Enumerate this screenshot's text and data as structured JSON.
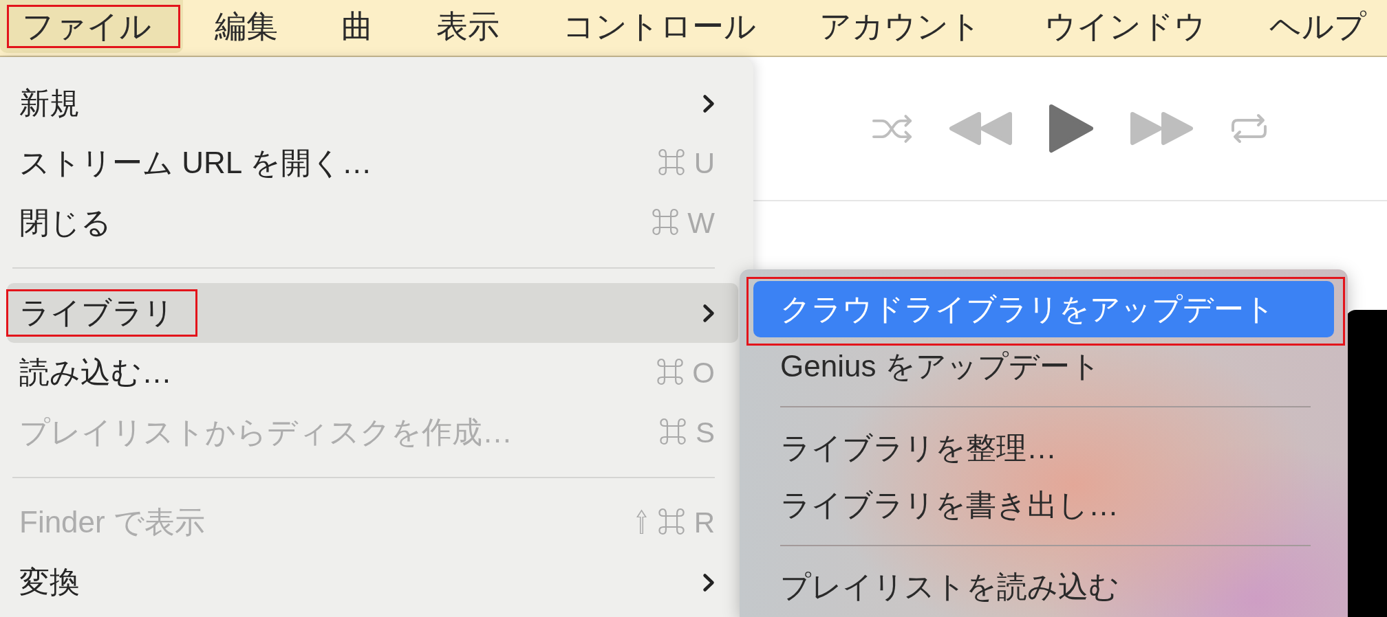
{
  "menu_bar": {
    "items": [
      {
        "label": "ファイル",
        "selected": true,
        "annotated": true
      },
      {
        "label": "編集",
        "selected": false,
        "annotated": false
      },
      {
        "label": "曲",
        "selected": false,
        "annotated": false
      },
      {
        "label": "表示",
        "selected": false,
        "annotated": false
      },
      {
        "label": "コントロール",
        "selected": false,
        "annotated": false
      },
      {
        "label": "アカウント",
        "selected": false,
        "annotated": false
      },
      {
        "label": "ウインドウ",
        "selected": false,
        "annotated": false
      },
      {
        "label": "ヘルプ",
        "selected": false,
        "annotated": false
      }
    ]
  },
  "file_menu": {
    "items": [
      {
        "kind": "item",
        "label": "新規",
        "submenu": true,
        "selected": false,
        "disabled": false,
        "annotated": false
      },
      {
        "kind": "item",
        "label": "ストリーム URL を開く…",
        "shortcut": "⌘ U",
        "selected": false,
        "disabled": false,
        "annotated": false
      },
      {
        "kind": "item",
        "label": "閉じる",
        "shortcut": "⌘ W",
        "selected": false,
        "disabled": false,
        "annotated": false
      },
      {
        "kind": "separator"
      },
      {
        "kind": "item",
        "label": "ライブラリ",
        "submenu": true,
        "selected": true,
        "disabled": false,
        "annotated": true
      },
      {
        "kind": "item",
        "label": "読み込む…",
        "shortcut": "⌘ O",
        "selected": false,
        "disabled": false,
        "annotated": false
      },
      {
        "kind": "item",
        "label": "プレイリストからディスクを作成…",
        "shortcut": "⌘ S",
        "selected": false,
        "disabled": true,
        "annotated": false
      },
      {
        "kind": "separator"
      },
      {
        "kind": "item",
        "label": "Finder で表示",
        "shortcut": "⇧ ⌘ R",
        "selected": false,
        "disabled": true,
        "annotated": false
      },
      {
        "kind": "item",
        "label": "変換",
        "submenu": true,
        "selected": false,
        "disabled": false,
        "annotated": false
      }
    ]
  },
  "library_submenu": {
    "items": [
      {
        "kind": "item",
        "label": "クラウドライブラリをアップデート",
        "selected": true,
        "annotated": true
      },
      {
        "kind": "item",
        "label": "Genius をアップデート",
        "selected": false,
        "annotated": false
      },
      {
        "kind": "separator"
      },
      {
        "kind": "item",
        "label": "ライブラリを整理…",
        "selected": false,
        "annotated": false
      },
      {
        "kind": "item",
        "label": "ライブラリを書き出し…",
        "selected": false,
        "annotated": false
      },
      {
        "kind": "separator"
      },
      {
        "kind": "item",
        "label": "プレイリストを読み込む",
        "selected": false,
        "annotated": false
      }
    ]
  },
  "player": {
    "controls": [
      {
        "kind": "shuffle",
        "disabled": true
      },
      {
        "kind": "rewind",
        "disabled": true
      },
      {
        "kind": "play",
        "disabled": false
      },
      {
        "kind": "fast_forward",
        "disabled": true
      },
      {
        "kind": "repeat",
        "disabled": true
      }
    ]
  }
}
